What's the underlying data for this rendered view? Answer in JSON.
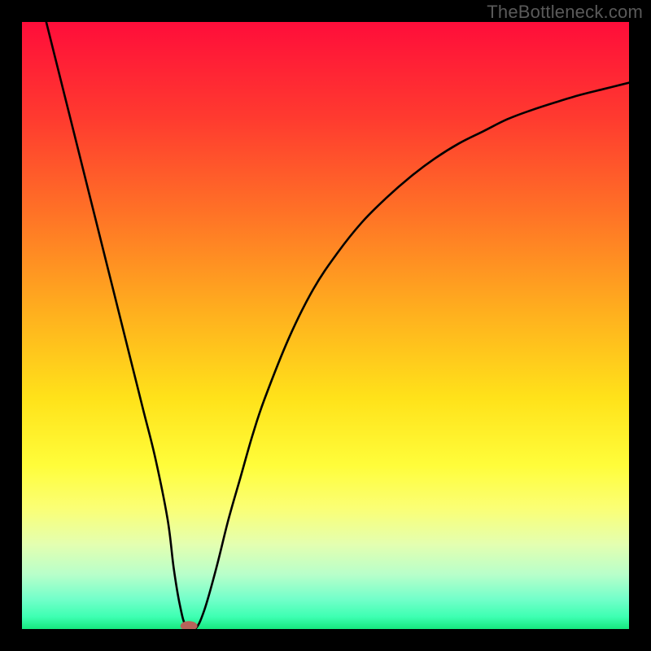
{
  "watermark": "TheBottleneck.com",
  "chart_data": {
    "type": "line",
    "title": "",
    "xlabel": "",
    "ylabel": "",
    "xlim": [
      0,
      100
    ],
    "ylim": [
      0,
      100
    ],
    "series": [
      {
        "name": "curve",
        "x": [
          4,
          6,
          8,
          10,
          12,
          14,
          16,
          18,
          20,
          22,
          24,
          25,
          26,
          27,
          28.5,
          30,
          32,
          34,
          36,
          38,
          40,
          44,
          48,
          52,
          56,
          60,
          64,
          68,
          72,
          76,
          80,
          84,
          88,
          92,
          96,
          100
        ],
        "y": [
          100,
          92,
          84,
          76,
          68,
          60,
          52,
          44,
          36,
          28,
          18,
          10,
          4,
          0.5,
          0,
          3,
          10,
          18,
          25,
          32,
          38,
          48,
          56,
          62,
          67,
          71,
          74.5,
          77.5,
          80,
          82,
          84,
          85.5,
          86.8,
          88,
          89,
          90
        ]
      }
    ],
    "marker": {
      "x": 27.5,
      "y": 0,
      "color": "#b7635a"
    },
    "bg_gradient": {
      "stops": [
        {
          "offset": 0,
          "color": "#ff0d3a"
        },
        {
          "offset": 16,
          "color": "#ff3b2f"
        },
        {
          "offset": 32,
          "color": "#ff7426"
        },
        {
          "offset": 48,
          "color": "#ffb01e"
        },
        {
          "offset": 62,
          "color": "#ffe21a"
        },
        {
          "offset": 73,
          "color": "#fffd3a"
        },
        {
          "offset": 80,
          "color": "#fbff74"
        },
        {
          "offset": 86,
          "color": "#e4ffb0"
        },
        {
          "offset": 91,
          "color": "#b8ffca"
        },
        {
          "offset": 95,
          "color": "#74ffca"
        },
        {
          "offset": 98,
          "color": "#3dffb2"
        },
        {
          "offset": 100,
          "color": "#16e87d"
        }
      ]
    }
  }
}
